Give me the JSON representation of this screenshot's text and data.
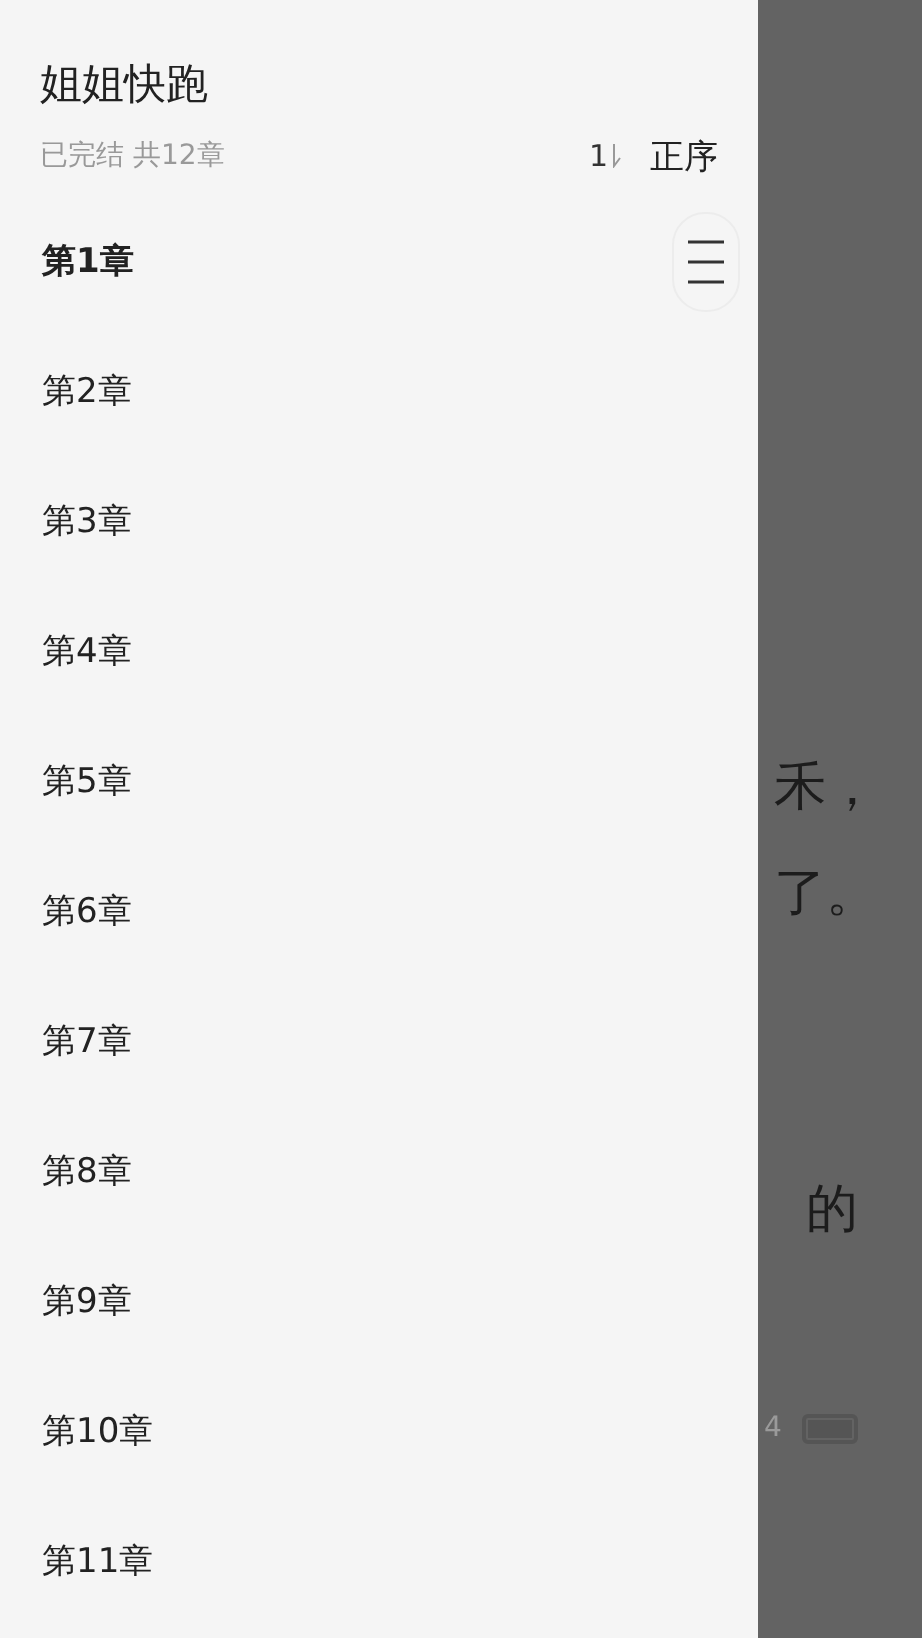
{
  "drawer": {
    "title": "姐姐快跑",
    "status": "已完结 共12章",
    "sort": {
      "digit": "1",
      "label": "正序"
    },
    "chapters": [
      {
        "title": "第1章",
        "selected": true
      },
      {
        "title": "第2章",
        "selected": false
      },
      {
        "title": "第3章",
        "selected": false
      },
      {
        "title": "第4章",
        "selected": false
      },
      {
        "title": "第5章",
        "selected": false
      },
      {
        "title": "第6章",
        "selected": false
      },
      {
        "title": "第7章",
        "selected": false
      },
      {
        "title": "第8章",
        "selected": false
      },
      {
        "title": "第9章",
        "selected": false
      },
      {
        "title": "第10章",
        "selected": false
      },
      {
        "title": "第11章",
        "selected": false
      }
    ]
  },
  "reader": {
    "lines": [
      "禾，",
      "了。",
      "的"
    ],
    "page": "4"
  }
}
